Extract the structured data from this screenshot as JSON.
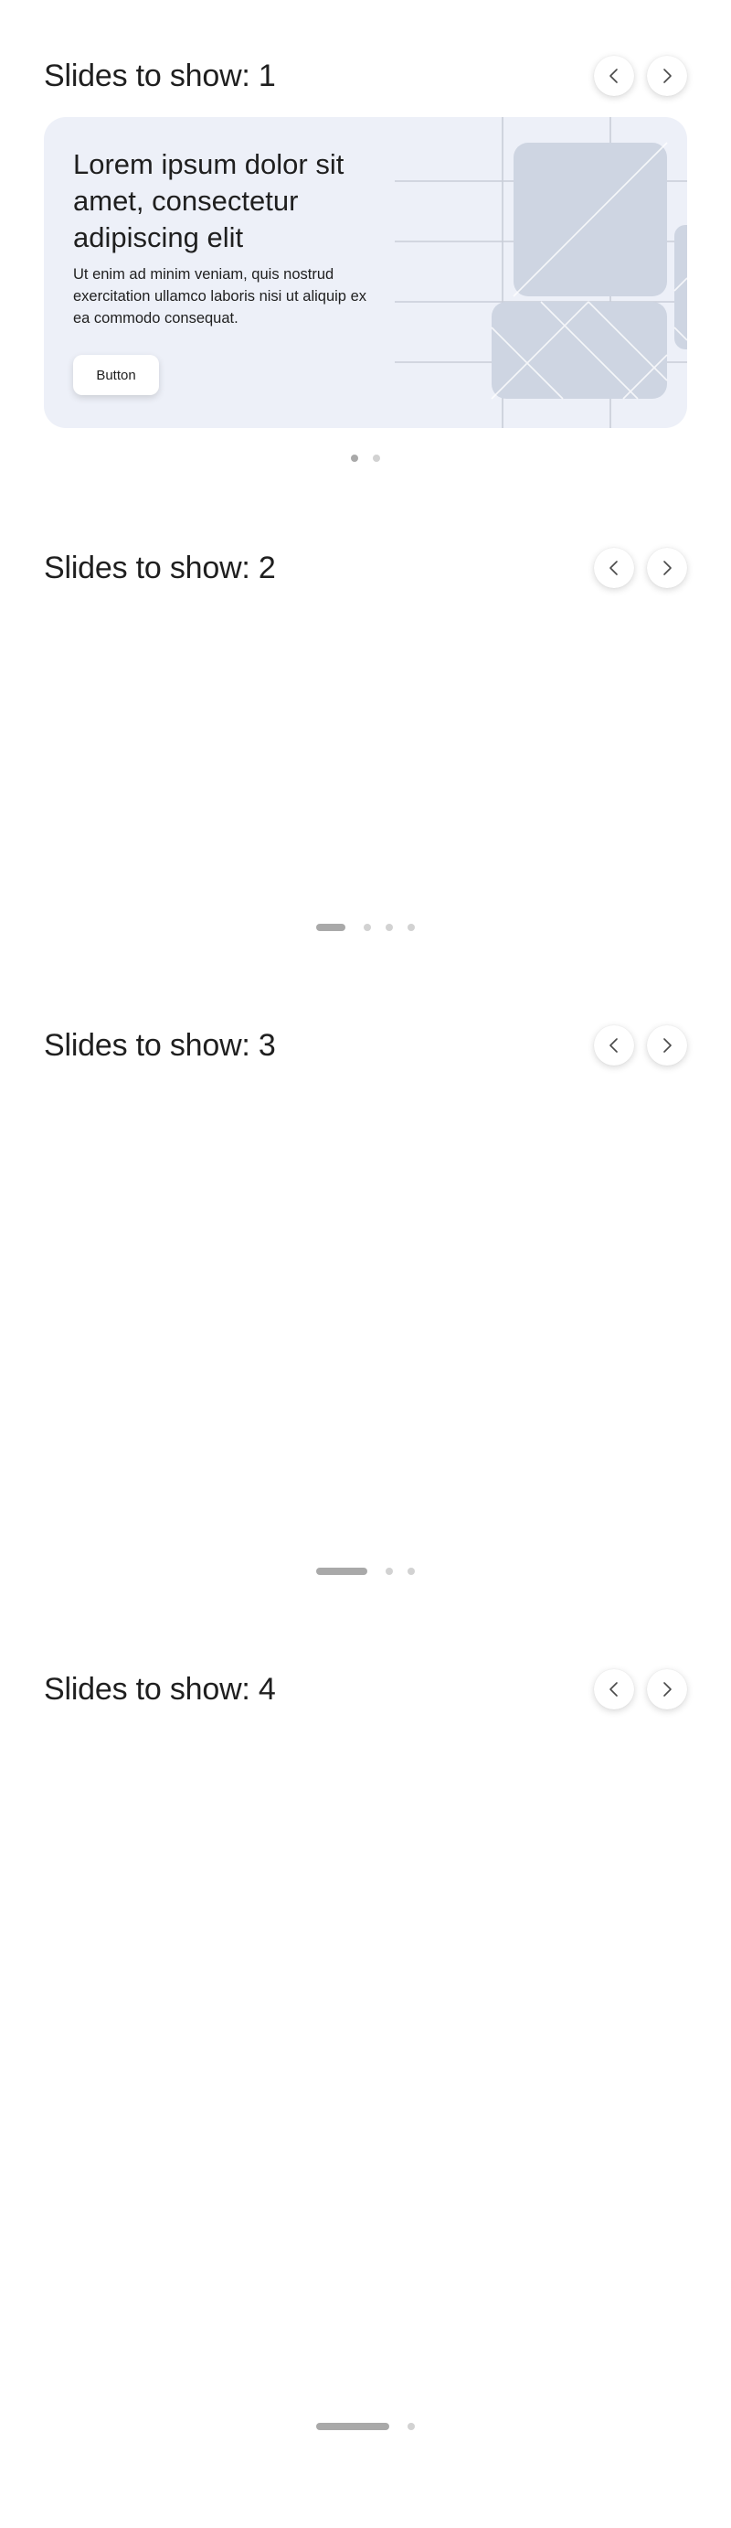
{
  "sections": [
    {
      "title": "Slides to show: 1",
      "slide": {
        "title": "Lorem ipsum dolor sit amet, consectetur adipiscing elit",
        "text": "Ut enim ad minim veniam, quis nostrud exercitation ullamco laboris nisi ut aliquip ex ea commodo consequat.",
        "button_label": "Button"
      },
      "dots_count": 2,
      "active_dot": 0
    },
    {
      "title": "Slides to show: 2",
      "dots_count": 4,
      "active_dot": 0
    },
    {
      "title": "Slides to show: 3",
      "dots_count": 3,
      "active_dot": 0
    },
    {
      "title": "Slides to show: 4",
      "dots_count": 2,
      "active_dot": 0
    }
  ],
  "icons": {
    "prev": "chevron-left-icon",
    "next": "chevron-right-icon"
  },
  "colors": {
    "slide_bg": "#edf0f8",
    "placeholder": "#ced5e2",
    "dot": "#d2d2d2",
    "dot_active": "#a9a9a9"
  }
}
